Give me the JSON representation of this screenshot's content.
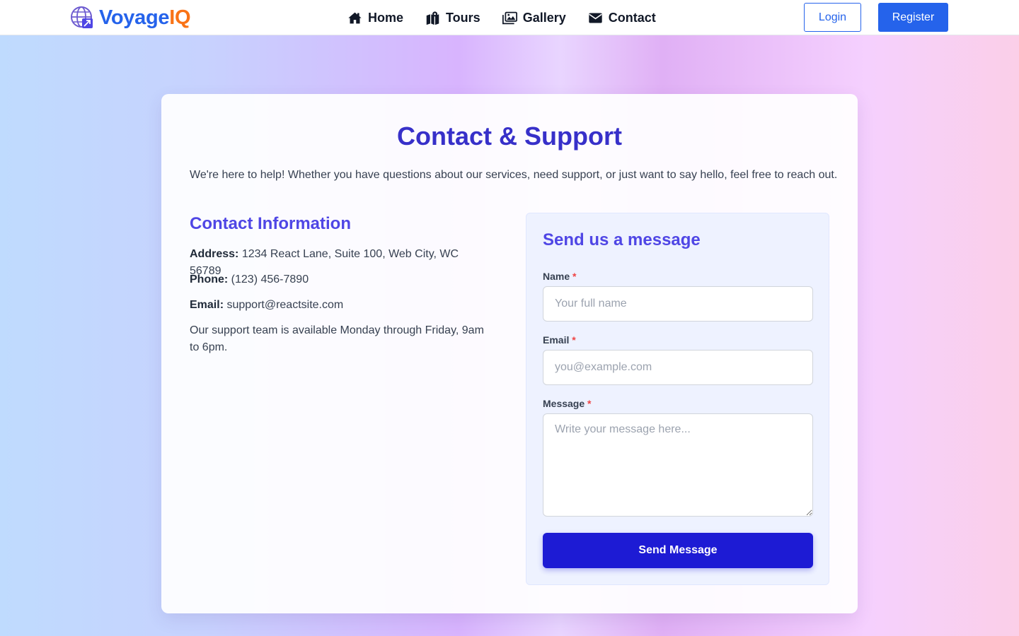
{
  "brand": {
    "name_part1": "Voyage",
    "name_part2": "IQ",
    "icon": "globe-plane-icon",
    "color_primary": "#2563eb",
    "color_accent": "#f97316"
  },
  "nav": {
    "items": [
      {
        "label": "Home",
        "icon": "home-icon"
      },
      {
        "label": "Tours",
        "icon": "map-icon"
      },
      {
        "label": "Gallery",
        "icon": "images-icon"
      },
      {
        "label": "Contact",
        "icon": "envelope-icon"
      }
    ],
    "login_label": "Login",
    "register_label": "Register"
  },
  "page": {
    "title": "Contact & Support",
    "intro": "We're here to help! Whether you have questions about our services, need support, or just want to say hello, feel free to reach out."
  },
  "contact_info": {
    "title": "Contact Information",
    "address_label": "Address:",
    "address_value": "1234 React Lane, Suite 100, Web City, WC 56789",
    "phone_label": "Phone:",
    "phone_value": "(123) 456-7890",
    "email_label": "Email:",
    "email_value": "support@reactsite.com",
    "availability": "Our support team is available Monday through Friday, 9am to 6pm."
  },
  "form": {
    "title": "Send us a message",
    "required_marker": "*",
    "name_label": "Name",
    "name_placeholder": "Your full name",
    "name_value": "",
    "email_label": "Email",
    "email_placeholder": "you@example.com",
    "email_value": "",
    "message_label": "Message",
    "message_placeholder": "Write your message here...",
    "message_value": "",
    "submit_label": "Send Message",
    "submit_color": "#1d1bd4"
  }
}
